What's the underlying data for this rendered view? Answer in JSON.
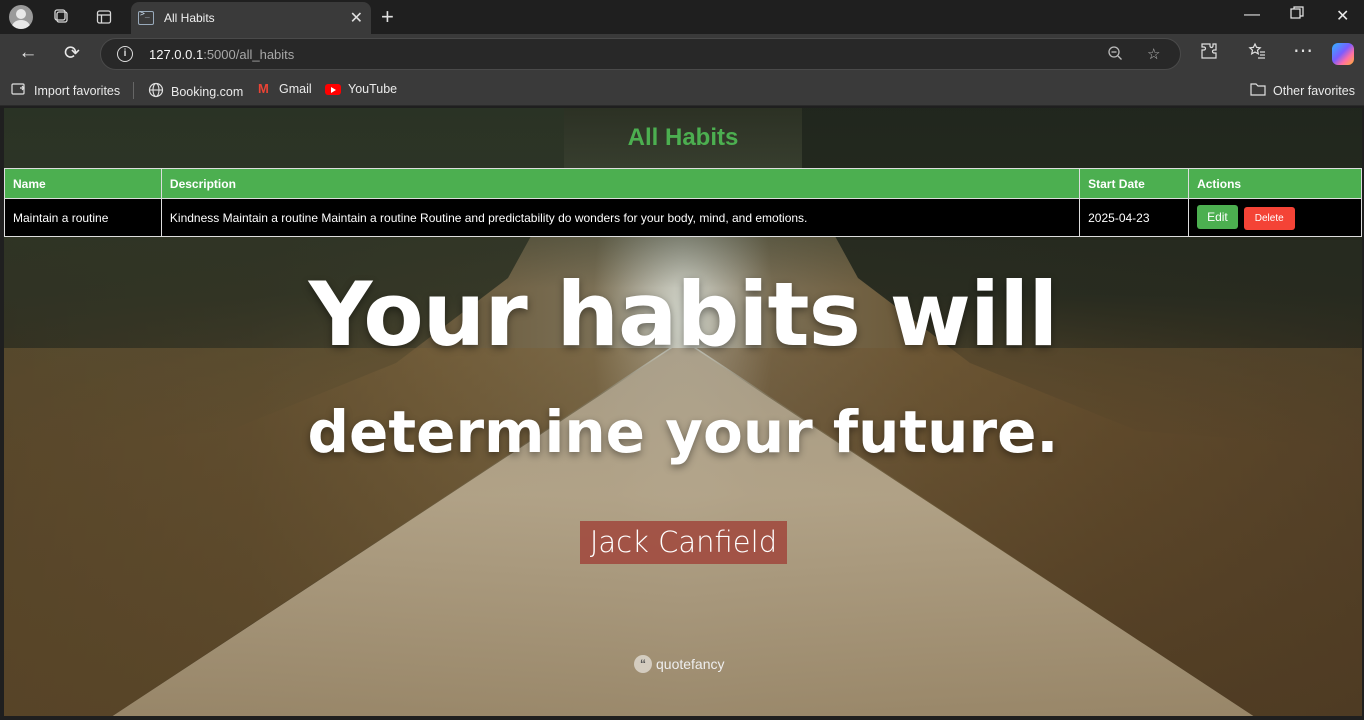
{
  "browser": {
    "tab_title": "All Habits",
    "url_host": "127.0.0.1",
    "url_path": ":5000/all_habits",
    "bookmarks": [
      {
        "label": "Import favorites"
      },
      {
        "label": "Booking.com"
      },
      {
        "label": "Gmail"
      },
      {
        "label": "YouTube"
      }
    ],
    "other_favorites": "Other favorites"
  },
  "page": {
    "title": "All Habits",
    "table": {
      "headers": [
        "Name",
        "Description",
        "Start Date",
        "Actions"
      ],
      "rows": [
        {
          "name": "Maintain a routine",
          "description": "Kindness Maintain a routine Maintain a routine Routine and predictability do wonders for your body, mind, and emotions.",
          "start_date": "2025-04-23",
          "edit_label": "Edit",
          "delete_label": "Delete"
        }
      ]
    },
    "quote": {
      "line1": "Your habits will",
      "line2": "determine your future.",
      "author": "Jack Canfield",
      "watermark": "quotefancy"
    }
  },
  "colors": {
    "accent_green": "#4caf50",
    "delete_red": "#f44336"
  }
}
